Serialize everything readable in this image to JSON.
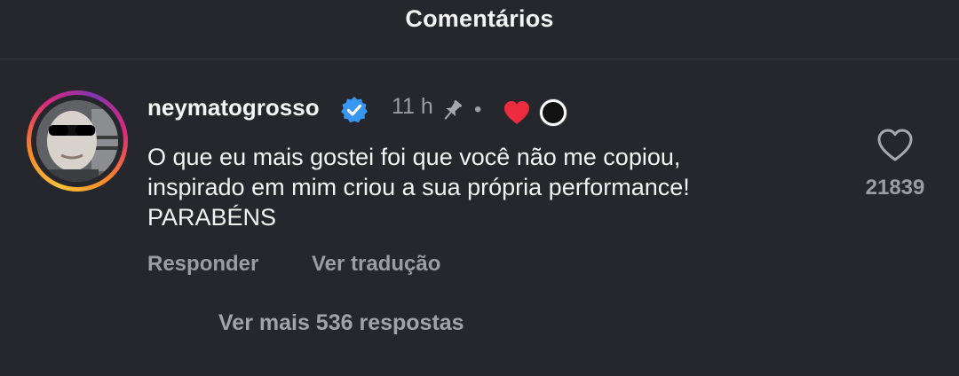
{
  "header": {
    "title": "Comentários"
  },
  "comment": {
    "username": "neymatogrosso",
    "time": "11 h",
    "separator": "•",
    "text_lines": [
      "O que eu mais gostei foi que você não me copiou,",
      "inspirado em mim criou a sua própria performance!",
      "PARABÉNS"
    ],
    "like_count": "21839",
    "actions": {
      "reply_label": "Responder",
      "translate_label": "Ver tradução"
    },
    "more_replies_label": "Ver mais 536 respostas",
    "icons": {
      "verified": "verified-badge-icon",
      "pin": "pin-icon",
      "creator_like": "creator-heart-icon",
      "like": "heart-outline-icon"
    },
    "colors": {
      "background": "#25272c",
      "verified_blue": "#3897f0",
      "heart_red": "#ed2b3f",
      "muted_text": "#9a9da3"
    }
  }
}
